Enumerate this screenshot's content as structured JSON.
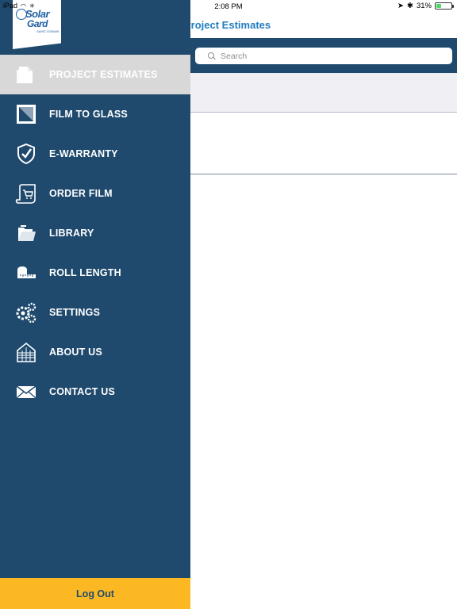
{
  "status_bar": {
    "device": "iPad",
    "time": "2:08 PM",
    "battery": "31%",
    "battery_level": 0.31
  },
  "main": {
    "title": "Project Estimates",
    "search_placeholder": "Search"
  },
  "drawer": {
    "logo": {
      "line1": "Solar",
      "line2": "Gard",
      "line3": "SAINT-GOBAIN"
    },
    "items": [
      {
        "label": "PROJECT ESTIMATES",
        "icon": "document-icon",
        "active": true
      },
      {
        "label": "FILM TO GLASS",
        "icon": "film-glass-icon",
        "active": false
      },
      {
        "label": "E-WARRANTY",
        "icon": "shield-check-icon",
        "active": false
      },
      {
        "label": "ORDER FILM",
        "icon": "cart-scroll-icon",
        "active": false
      },
      {
        "label": "LIBRARY",
        "icon": "folder-icon",
        "active": false
      },
      {
        "label": "ROLL LENGTH",
        "icon": "tape-measure-icon",
        "active": false
      },
      {
        "label": "SETTINGS",
        "icon": "gears-icon",
        "active": false
      },
      {
        "label": "ABOUT US",
        "icon": "building-icon",
        "active": false
      },
      {
        "label": "CONTACT US",
        "icon": "envelope-icon",
        "active": false
      }
    ],
    "logout_label": "Log Out"
  },
  "colors": {
    "drawer_bg": "#1f4a6e",
    "active_bg": "#d8d8d8",
    "logout_bg": "#fbb822",
    "title_blue": "#1f7dbf"
  }
}
